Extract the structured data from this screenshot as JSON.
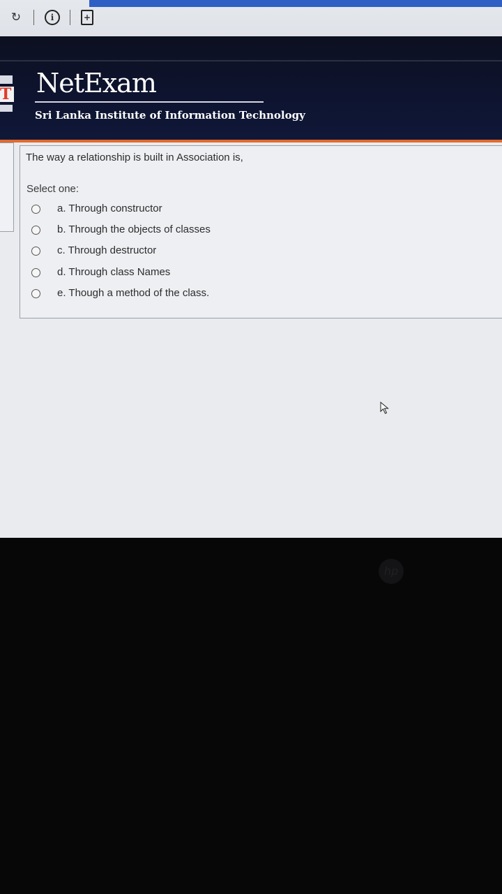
{
  "browser": {
    "icons": [
      "refresh-icon",
      "info-icon",
      "page-icon"
    ]
  },
  "header": {
    "title": "NetExam",
    "subtitle": "Sri Lanka Institute of Information Technology"
  },
  "question": {
    "text": "The way a relationship is built in Association is,",
    "prompt": "Select one:",
    "options": [
      {
        "label": "a. Through constructor",
        "selected": false
      },
      {
        "label": "b. Through the objects of classes",
        "selected": false
      },
      {
        "label": "c. Through destructor",
        "selected": false
      },
      {
        "label": "d. Through class Names",
        "selected": false
      },
      {
        "label": "e. Though a method of the class.",
        "selected": false
      }
    ]
  },
  "colors": {
    "header_bg": "#0e1430",
    "accent_orange": "#e36a2c",
    "browser_blue": "#2f5fc4"
  }
}
